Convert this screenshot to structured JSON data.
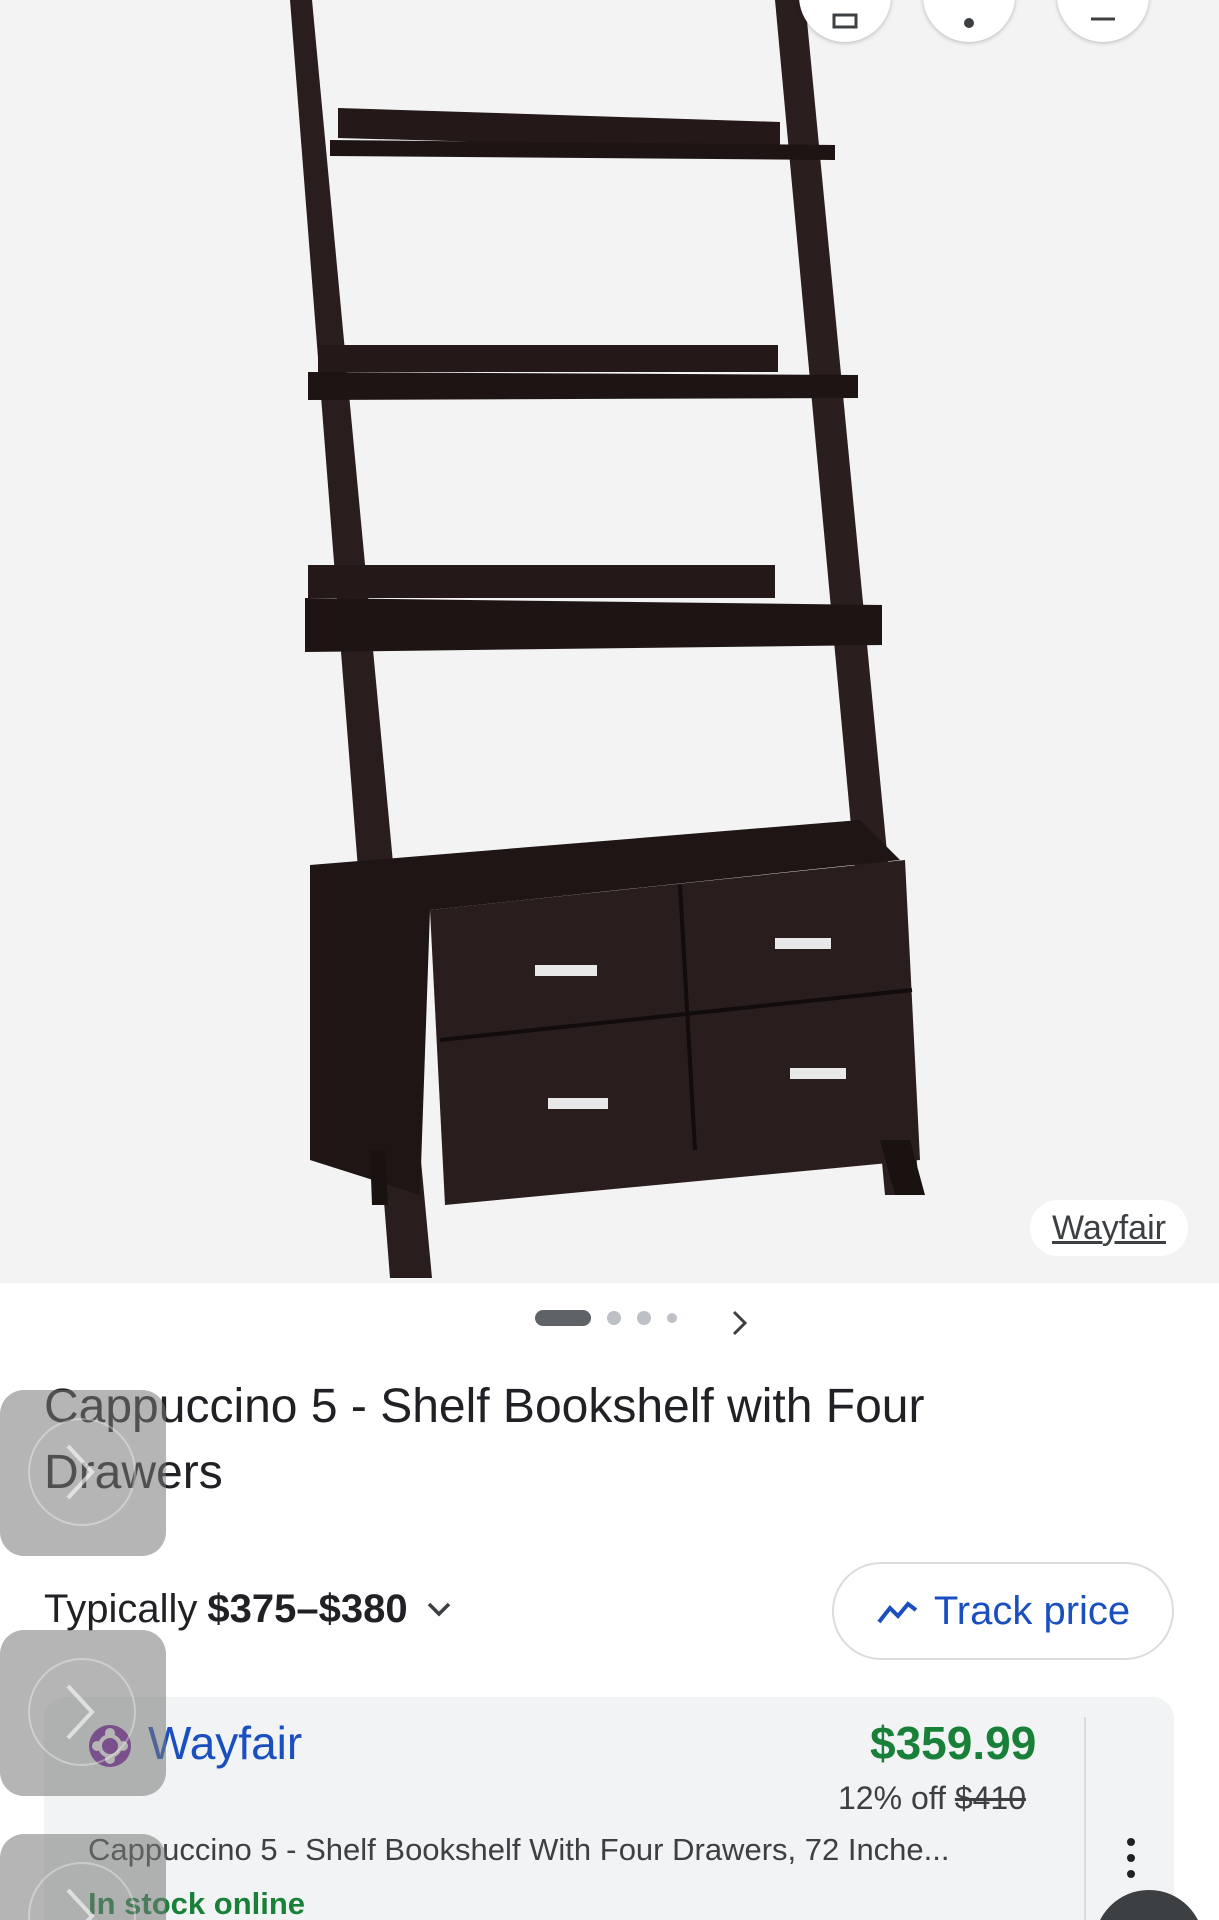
{
  "hero": {
    "source_chip": "Wayfair",
    "top_buttons": [
      "save-icon",
      "more-icon",
      "cart-icon"
    ],
    "image_alt_icon": "bookshelf-ladder-image",
    "carousel": {
      "total": 4,
      "active": 1
    }
  },
  "product": {
    "title": "Cappuccino 5 - Shelf Bookshelf with Four Drawers"
  },
  "pricing": {
    "typically_label": "Typically",
    "typical_range": "$375–$380",
    "track_label": "Track price"
  },
  "offer": {
    "store": "Wayfair",
    "price": "$359.99",
    "discount": "12% off",
    "original_price": "$410",
    "description": "Cappuccino 5 - Shelf Bookshelf With Four Drawers, 72 Inche...",
    "stock": "In stock online"
  },
  "colors": {
    "price_green": "#188038",
    "link_blue": "#1a4fbf",
    "wood": "#2a1d1d",
    "store_logo": "#7b1fa2"
  }
}
